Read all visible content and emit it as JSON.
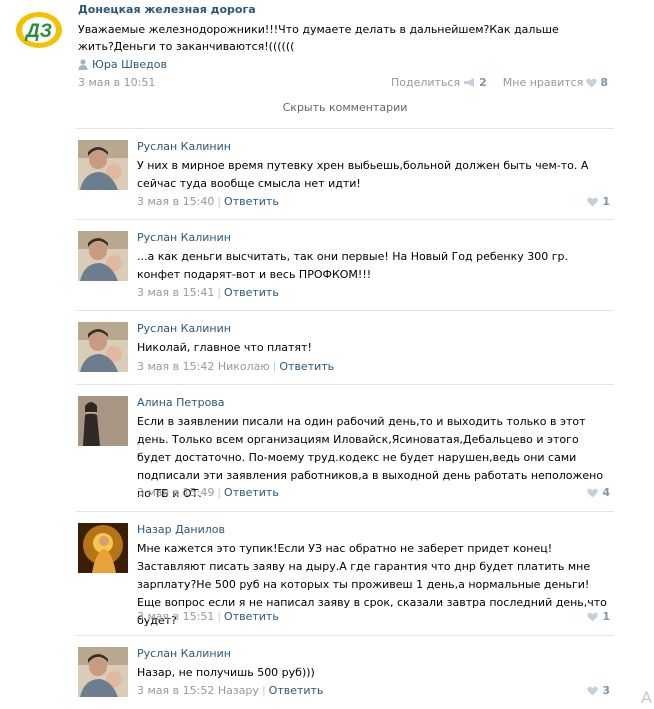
{
  "post": {
    "group_name": "Донецкая железная дорога",
    "logo_letters": "ДЗ",
    "text": "Уважаемые железнодорожники!!!Что думаете делать в дальнейшем?Как дальше жить?Деньги то заканчиваются!((((((",
    "author": "Юра Шведов",
    "date": "3 мая в 10:51",
    "share_label": "Поделиться",
    "share_count": "2",
    "like_label": "Мне нравится",
    "like_count": "8"
  },
  "hide_comments_label": "Скрыть комментарии",
  "reply_label": "Ответить",
  "comments": [
    {
      "author": "Руслан Калинин",
      "text": "У них в мирное время путевку хрен выбьешь,больной должен быть чем-то. А сейчас туда вообще смысла нет идти!",
      "date": "3 мая в 15:40",
      "to": "",
      "likes": "1"
    },
    {
      "author": "Руслан Калинин",
      "text": "...а как деньги высчитать, так они первые! На Новый Год ребенку 300 гр. конфет подарят-вот и весь ПРОФКОМ!!!",
      "date": "3 мая в 15:41",
      "to": "",
      "likes": ""
    },
    {
      "author": "Руслан Калинин",
      "text": "Николай, главное что платят!",
      "date": "3 мая в 15:42",
      "to": "Николаю",
      "likes": ""
    },
    {
      "author": "Алина Петрова",
      "text": "Если в заявлении писали на один рабочий день,то и выходить только в этот день. Только всем организациям Иловайск,Ясиноватая,Дебальцево и этого будет достаточно. По-моему труд.кодекс не будет нарушен,ведь они сами подписали эти заявления работников,а в выходной день работать неположено по ТБ и ОТ.",
      "date": "3 мая в 15:49",
      "to": "",
      "likes": "4"
    },
    {
      "author": "Назар Данилов",
      "text": "Мне кажется это тупик!Если УЗ нас обратно не заберет придет конец!Заставляют писать заяву на дыру.А где гарантия что днр будет платить мне зарплату?Не 500 руб на которых ты проживеш 1 день,а нормальные деньги!Еще вопрос если я не написал заяву в срок, сказали завтра последний день,что будет?",
      "date": "3 мая в 15:51",
      "to": "",
      "likes": "1"
    },
    {
      "author": "Руслан Калинин",
      "text": "Назар, не получишь 500 руб)))",
      "date": "3 мая в 15:52",
      "to": "Назару",
      "likes": "3"
    }
  ],
  "corner_glyph": "А",
  "colors": {
    "link": "#2b587a",
    "muted": "#999999",
    "divider": "#dfe4ea",
    "like": "#7f95aa"
  }
}
